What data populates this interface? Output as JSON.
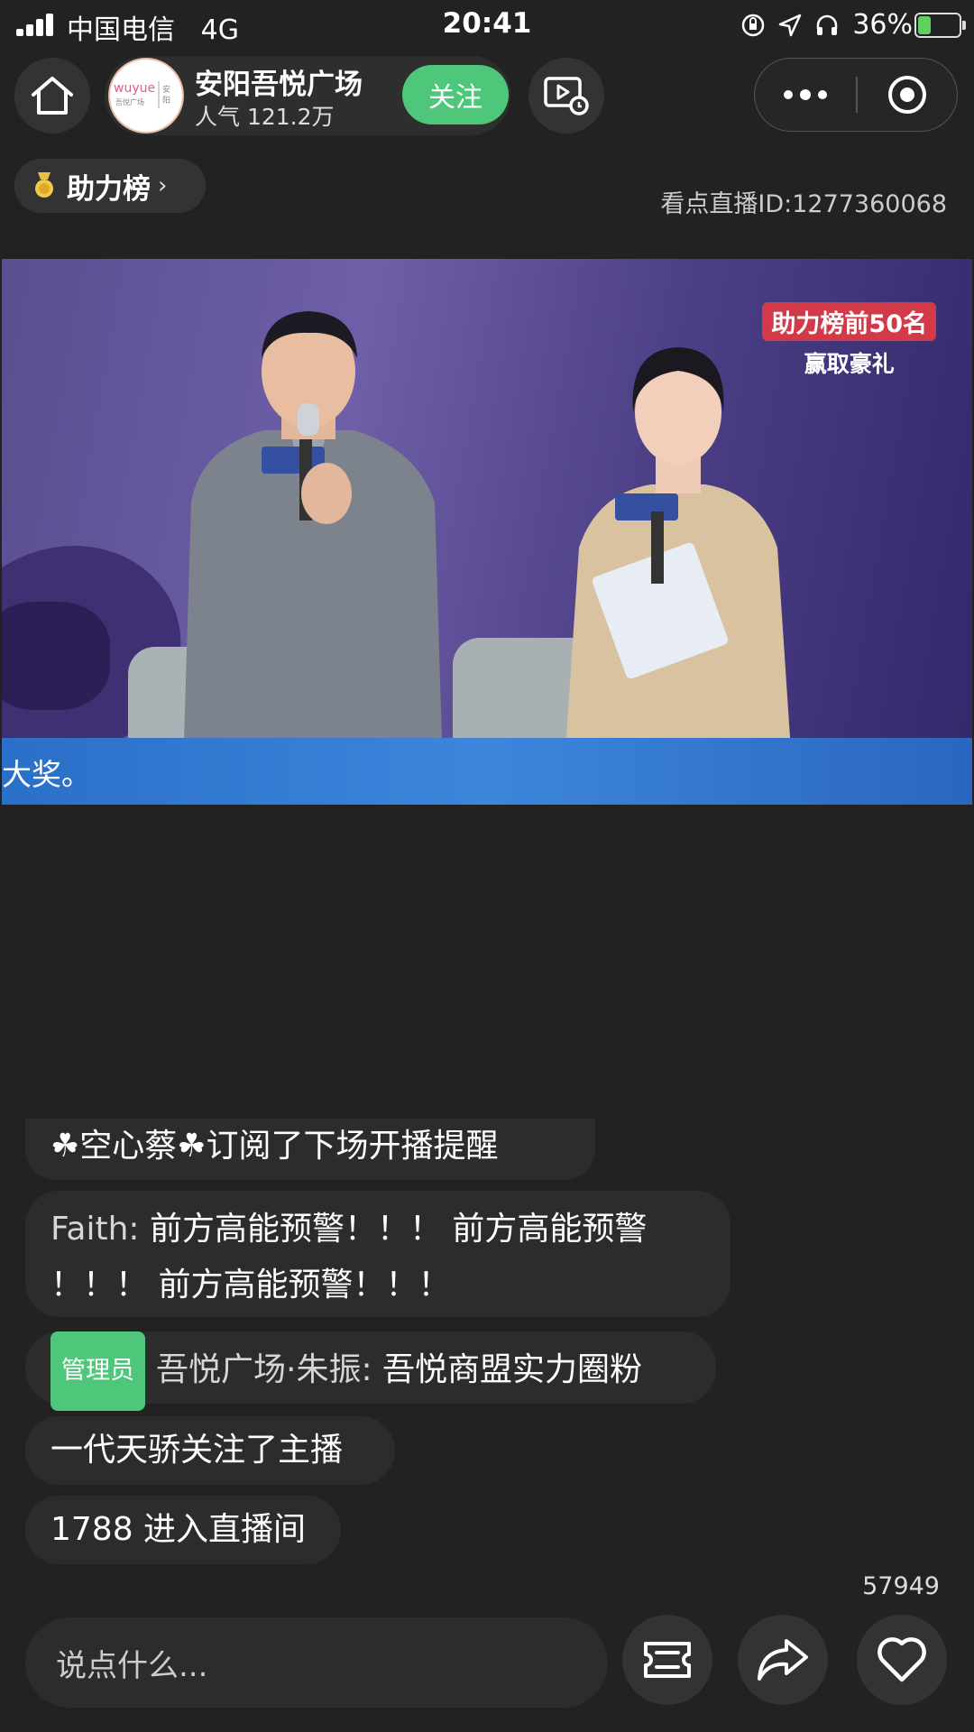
{
  "status_bar": {
    "carrier": "中国电信",
    "network": "4G",
    "time": "20:41",
    "battery": "36%",
    "battery_level": 0.36,
    "icons": [
      "orientation-lock-icon",
      "location-icon",
      "headphones-icon"
    ]
  },
  "header": {
    "anchor_name": "安阳吾悦广场",
    "popularity": "人气 121.2万",
    "follow_label": "关注",
    "avatar_text": "WUYUE 吾悦广场 安阳"
  },
  "rank": {
    "label": "助力榜",
    "chevron": "›"
  },
  "live_id": "看点直播ID:1277360068",
  "video": {
    "promo_line1": "助力榜前50名",
    "promo_line2": "赢取豪礼",
    "caption": "大奖。"
  },
  "chat": {
    "messages": [
      {
        "text": "☘空心蔡☘订阅了下场开播提醒"
      },
      {
        "user": "Faith:",
        "text": "前方高能预警！！！ 前方高能预警",
        "text2": "！！！ 前方高能预警！！！"
      },
      {
        "tag": "管理员",
        "user": "吾悦广场·朱振:",
        "text": "吾悦商盟实力圈粉"
      },
      {
        "text": "一代天骄关注了主播"
      },
      {
        "text": "1788  进入直播间"
      }
    ]
  },
  "likes": "57949",
  "input": {
    "placeholder": "说点什么..."
  },
  "colors": {
    "accent_green": "#4ec77a",
    "background": "#222222",
    "caption_blue": "#3d86dc"
  }
}
